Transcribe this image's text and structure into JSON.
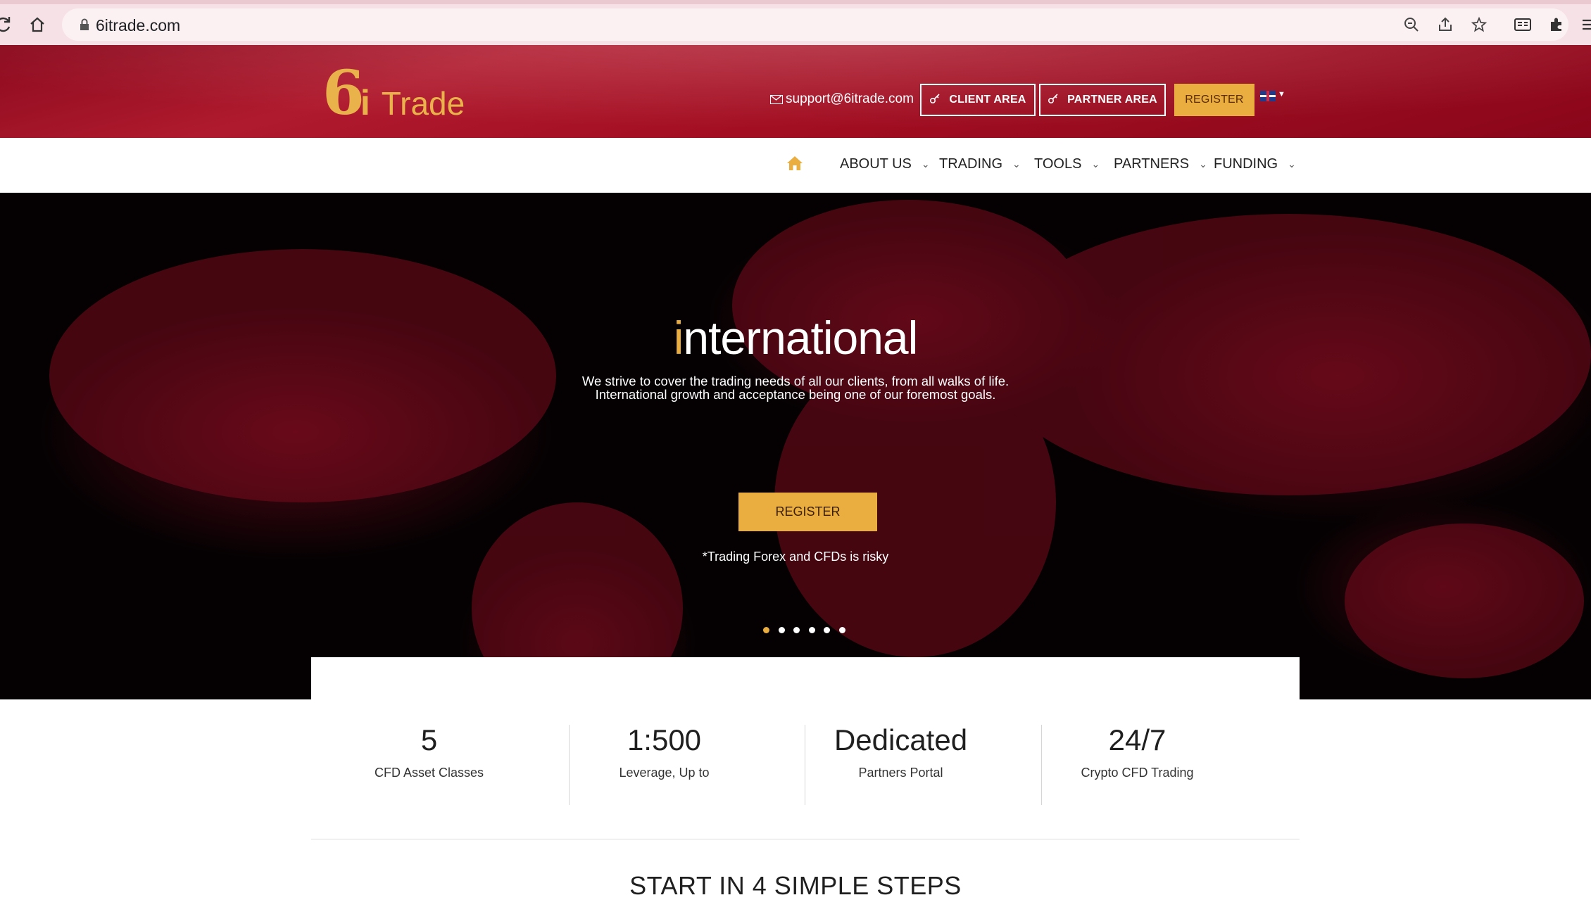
{
  "browser": {
    "url": "6itrade.com"
  },
  "header": {
    "logo_six": "6",
    "logo_i": "i",
    "logo_trade": "Trade",
    "email": "support@6itrade.com",
    "client_area_label": "CLIENT AREA",
    "partner_area_label": "PARTNER AREA",
    "register_label": "REGISTER",
    "language": "en-GB-flag"
  },
  "nav": {
    "items": [
      {
        "label": "ABOUT US"
      },
      {
        "label": "TRADING"
      },
      {
        "label": "TOOLS"
      },
      {
        "label": "PARTNERS"
      },
      {
        "label": "FUNDING"
      }
    ]
  },
  "hero": {
    "title_first": "i",
    "title_rest": "nternational",
    "desc_line1": "We strive to cover the trading needs of all our clients, from all walks of life.",
    "desc_line2": "International growth and acceptance being one of our foremost goals.",
    "cta_label": "REGISTER",
    "note": "*Trading Forex and CFDs is risky",
    "slide_count": 6,
    "active_slide": 1
  },
  "stats": [
    {
      "value": "5",
      "label": "CFD Asset Classes"
    },
    {
      "value": "1:500",
      "label": "Leverage, Up to"
    },
    {
      "value": "Dedicated",
      "label": "Partners Portal"
    },
    {
      "value": "24/7",
      "label": "Crypto CFD Trading"
    }
  ],
  "steps_title": "START IN 4 SIMPLE STEPS",
  "colors": {
    "brand_red": "#a30e22",
    "accent_gold": "#e9ad40"
  }
}
